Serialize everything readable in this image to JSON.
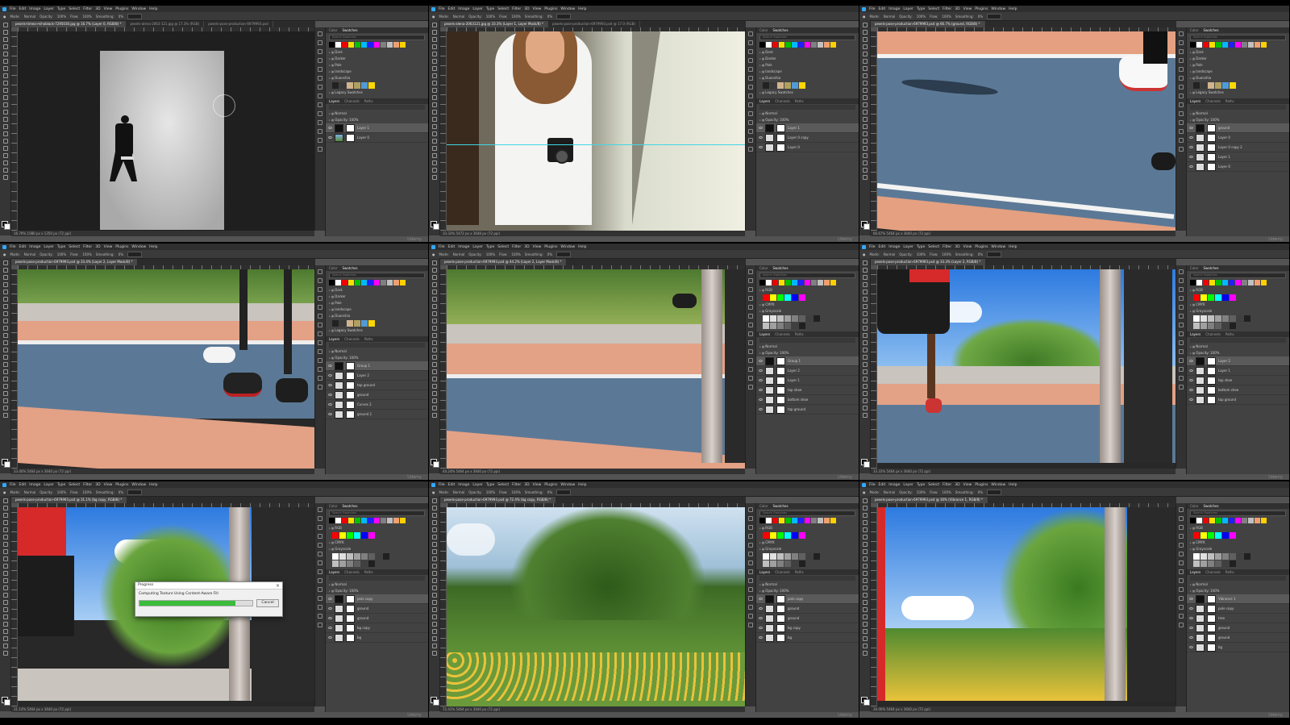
{
  "menu": [
    "File",
    "Edit",
    "Image",
    "Layer",
    "Type",
    "Select",
    "Filter",
    "3D",
    "View",
    "Plugins",
    "Window",
    "Help"
  ],
  "options": [
    "Mode:",
    "Normal",
    "Opacity:",
    "100%",
    "Flow:",
    "100%",
    "Smoothing:",
    "0%"
  ],
  "panel_tabs": [
    "Color",
    "Swatches"
  ],
  "layer_tabs": [
    "Layers",
    "Channels",
    "Paths"
  ],
  "search_placeholder": "Search Swatches",
  "blend_mode": "Normal",
  "opacity_label": "Opacity: 100%",
  "watermark": "Udemy",
  "colors": {
    "ps_blue": "#31a8ff",
    "progress_green": "#3bbd3b",
    "panel_bg": "#424242",
    "app_bg": "#535353"
  },
  "windows": [
    {
      "tabs": [
        "pexels-timea-mihoblack-7295030.jpg @ 16.7% (Layer 0, RGB/8) *",
        "pexels-alena-2063-121.jpg @ 17.3% (RGB)",
        "pexels-pose-production-6979993.psd"
      ],
      "folders": [
        "Dark",
        "Darker",
        "Pale",
        "landscape",
        "Duanshia",
        "Legacy Swatches"
      ],
      "layers": [
        "Layer 1",
        "Layer 0"
      ],
      "status": "16.79%   1080 px x 1350 px (72 ppi)"
    },
    {
      "tabs": [
        "pexels-alena-2063121.jpg @ 33.3% (Layer 1, Layer Mask/8) *",
        "pexels-pose-production-6979993.psd @ 17.0 (RGB)"
      ],
      "folders": [
        "Dark",
        "Darker",
        "Pale",
        "landscape",
        "Duanshia",
        "Legacy Swatches"
      ],
      "layers": [
        "Layer 1",
        "Layer 0 copy",
        "Layer 0"
      ],
      "status": "33.33%   5472 px x 3648 px (72 ppi)"
    },
    {
      "tabs": [
        "pexels-pose-production-6979993.psd @ 66.7% (ground, RGB/8) *"
      ],
      "folders": [
        "Dark",
        "Darker",
        "Pale",
        "landscape",
        "Duanshia",
        "Legacy Swatches"
      ],
      "layers": [
        "ground",
        "Layer 0",
        "Layer 0 copy 2",
        "Layer 1",
        "Layer 0"
      ],
      "status": "66.67%   5464 px x 3640 px (72 ppi)"
    },
    {
      "tabs": [
        "pexels-pose-production-6979993.psd @ 33.4% (Layer 2, Layer Mask/8) *"
      ],
      "folders": [
        "Dark",
        "Darker",
        "Pale",
        "landscape",
        "Duanshia",
        "Legacy Swatches"
      ],
      "layers": [
        "Group 1",
        "Layer 2",
        "top ground",
        "ground",
        "Curves 2",
        "ground 2"
      ],
      "status": "33.40%   5464 px x 3640 px (72 ppi)"
    },
    {
      "tabs": [
        "pexels-pose-production-6979993.psd @ 44.2% (Layer 2, Layer Mask/8) *"
      ],
      "folders": [
        "RGB",
        "CMYK",
        "Grayscale"
      ],
      "layers": [
        "Group 1",
        "Layer 2",
        "Layer 1",
        "top shoe",
        "bottom shoe",
        "top ground"
      ],
      "status": "44.24%   5464 px x 3640 px (72 ppi)"
    },
    {
      "tabs": [
        "pexels-pose-production-6979993.psd @ 33.3% (Layer 2, RGB/8) *"
      ],
      "folders": [
        "RGB",
        "CMYK",
        "Grayscale"
      ],
      "layers": [
        "Layer 2",
        "Layer 1",
        "top shoe",
        "bottom shoe",
        "top ground"
      ],
      "status": "33.33%   5464 px x 3640 px (72 ppi)"
    },
    {
      "tabs": [
        "pexels-pose-production-6979993.psd @ 31.1% (bg copy, RGB/8) *"
      ],
      "folders": [
        "RGB",
        "CMYK",
        "Grayscale"
      ],
      "layers": [
        "pole copy",
        "ground",
        "ground",
        "bg copy",
        "bg"
      ],
      "status": "31.14%   5464 px x 3640 px (72 ppi)",
      "progress": {
        "title": "Progress",
        "message": "Computing Texture Using Content-Aware Fill",
        "percent": 0.85,
        "cancel": "Cancel"
      }
    },
    {
      "tabs": [
        "pexels-pose-production-6979993.psd @ 72.4% (bg copy, RGB/8) *"
      ],
      "folders": [
        "RGB",
        "CMYK",
        "Grayscale"
      ],
      "layers": [
        "pole copy",
        "ground",
        "ground",
        "bg copy",
        "bg"
      ],
      "status": "72.41%   5464 px x 3640 px (72 ppi)"
    },
    {
      "tabs": [
        "pexels-pose-production-6979993.psd @ 30% (Vibrance 1, RGB/8) *"
      ],
      "folders": [
        "RGB",
        "CMYK",
        "Grayscale"
      ],
      "layers": [
        "Vibrance 1",
        "pole copy",
        "tree",
        "ground",
        "ground",
        "bg"
      ],
      "status": "30.00%   5464 px x 3640 px (72 ppi)"
    }
  ]
}
